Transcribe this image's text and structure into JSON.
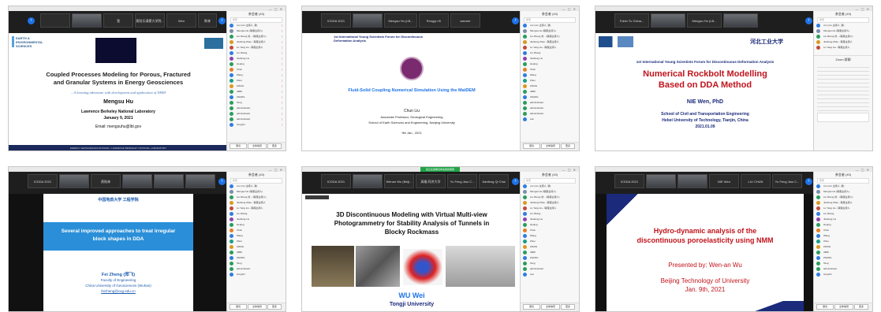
{
  "panel": {
    "title": "参会者 (43)",
    "search_placeholder": "搜索",
    "invite_label": "邀请",
    "mute_all_label": "全体静音",
    "more_label": "更多"
  },
  "participants": [
    "xxx (xxx 主持人, 我)",
    "Mengsu Hu (联席主持人)",
    "Liu Zheng 刘... (联席主持人)",
    "Jianfeng Zhao - 联席主持人",
    "Lu Yang Liu - 联席主持人",
    "Lin Zhang",
    "Jianfeng Liu",
    "Heqing",
    "Chen",
    "Wang",
    "Zhou",
    "ZIANG",
    "ABDI",
    "ZHANG",
    "Tang",
    "administrator",
    "administrator",
    "administrator",
    "hongzhi",
    "Lan"
  ],
  "shots": [
    {
      "thumbs": [
        "",
        "",
        "我",
        "燕阳乐清蒙大学院...",
        "Wen",
        "陈林"
      ],
      "slide": {
        "logo": "EARTH & ENVIRONMENTAL SCIENCES",
        "title_a": "Coupled Processes Modeling for Porous, Fractured",
        "title_b": "and Granular Systems in Energy Geosciences",
        "subtitle": "– A learning adventure with development and application of NMM",
        "presenter": "Mengsu Hu",
        "affiliation": "Lawrence Berkeley National Laboratory",
        "date": "January 9, 2021",
        "email": "Email: mengsuhu@lbl.gov",
        "footer": "ENERGY GEOSCIENCES DIVISION • LAWRENCE BERKELEY NATIONAL LABORATORY"
      }
    },
    {
      "thumbs": [
        "ICDDA 2021",
        "",
        "Mengsu Hu (LB...",
        "Rongyu Ki",
        "wanner"
      ],
      "slide": {
        "header": "1st International Young Scientists Forum for Discontinuous Deformation Analysis",
        "title": "Fluid-Solid Coupling Numerical Simulation Using the MatDEM",
        "presenter": "Chun Liu",
        "role": "Associate Professor, Geological Engineering",
        "affiliation": "School of Earth Sciences and Engineering, Nanjing University",
        "date": "9th Jan., 2021"
      }
    },
    {
      "thumbs": [
        "Fubin Tu China...",
        "",
        "Mengsu Hu (LB...",
        ""
      ],
      "slide": {
        "university": "河北工业大学",
        "header": "1st International Young Scientists Forum for Discontinuous Deformation Analysis",
        "title_a": "Numerical Rockbolt Modelling",
        "title_b": "Based on DDA Method",
        "presenter": "NIE Wen, PhD",
        "affiliation_a": "School of Civil and Transportation Engineering",
        "affiliation_b": "Hebei University of Technology, Tianjin, China",
        "date": "2021.01.09"
      },
      "chat_title": "Zoom 群聊"
    },
    {
      "thumbs": [
        "ICDDA 2021",
        "",
        "燕陆林",
        "",
        "",
        ""
      ],
      "slide": {
        "school": "中国地质大学 工程学院",
        "title_a": "Several improved approaches to treat irregular",
        "title_b": "block shapes in DDA",
        "presenter": "Fei Zheng (郑飞)",
        "faculty": "Faculty of Engineering",
        "affiliation": "China University of Geosciences (Wuhan)",
        "email": "feizheng@cug.edu.cn"
      }
    },
    {
      "banner": "您正在观看该参会者的屏幕",
      "thumbs": [
        "ICDDA 2021",
        "",
        "Wenan Wu (Beiji...",
        "高福 同济大学",
        "Yu Feng Jiao C...",
        "Jianfeng Qi Chai"
      ],
      "slide": {
        "title_a": "3D Discontinuous Modeling with Virtual Multi-view",
        "title_b": "Photogrammetry for Stability Analysis of Tunnels in",
        "title_c": "Blocky Rockmass",
        "presenter": "WU Wei",
        "affiliation": "Tongji University"
      }
    },
    {
      "thumbs": [
        "ICDDA 2021",
        "",
        "",
        "NIE Wen",
        "LIU CHUN",
        "Yu Feng Jiao C..."
      ],
      "slide": {
        "title_a": "Hydro-dynamic analysis of the",
        "title_b": "discontinuous poroelasticity using NMM",
        "presenter": "Presented by: Wen-an Wu",
        "affiliation": "Beijing Technology of University",
        "date": "Jan. 9th, 2021"
      }
    }
  ],
  "colors": {
    "accent": "#1e73e8",
    "maroon": "#c0141c",
    "navy": "#1b2a7a",
    "blue_banner": "#2a8fd8"
  }
}
